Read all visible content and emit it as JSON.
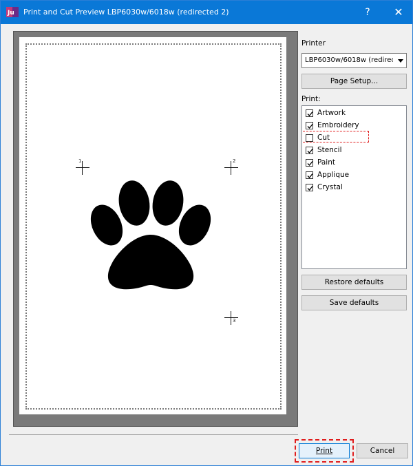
{
  "window": {
    "title": "Print and Cut Preview LBP6030w/6018w (redirected 2)",
    "help_label": "?",
    "close_label": "✕",
    "titlebar_color": "#0a78d7"
  },
  "preview": {
    "registration_marks": [
      "1",
      "2",
      "3"
    ],
    "artwork_icon": "paw-print-icon"
  },
  "panel": {
    "printer_label": "Printer",
    "printer_value": "LBP6030w/6018w (redirec",
    "page_setup_label": "Page Setup...",
    "print_label": "Print:",
    "items": [
      {
        "label": "Artwork",
        "checked": true
      },
      {
        "label": "Embroidery",
        "checked": true
      },
      {
        "label": "Cut",
        "checked": false
      },
      {
        "label": "Stencil",
        "checked": true
      },
      {
        "label": "Paint",
        "checked": true
      },
      {
        "label": "Applique",
        "checked": true
      },
      {
        "label": "Crystal",
        "checked": true
      }
    ],
    "restore_defaults_label": "Restore defaults",
    "save_defaults_label": "Save defaults"
  },
  "footer": {
    "print_button": "Print",
    "cancel_button": "Cancel"
  },
  "colors": {
    "highlight": "#e01d1d",
    "accent": "#0078d7"
  }
}
